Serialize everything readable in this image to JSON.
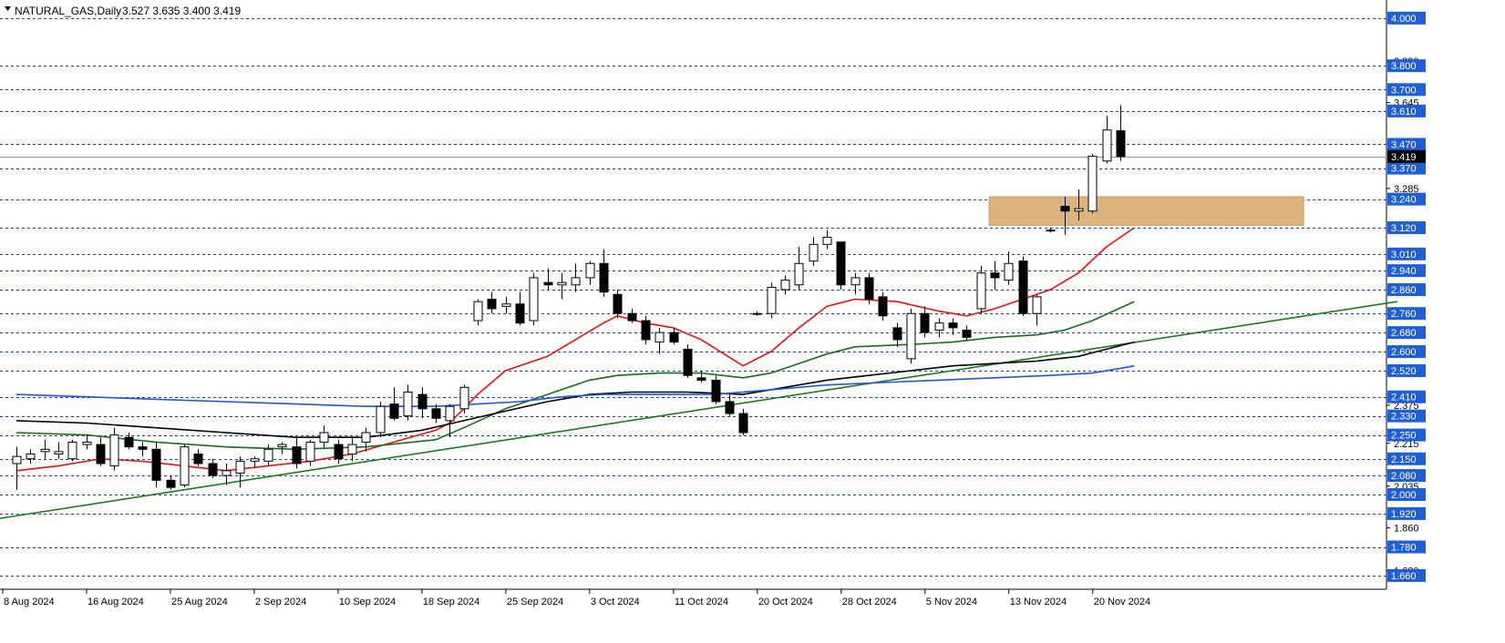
{
  "header": {
    "symbol": "NATURAL_GAS,Daily",
    "ohlc": "3.527 3.635 3.400 3.419"
  },
  "colors": {
    "background": "#ffffff",
    "level_line": "#1f3f9f",
    "level_label": "#1f5fd6",
    "zone": "#dcb47f",
    "ma_fast": "#e81010",
    "ma_mid": "#1a6b1a",
    "ma_black": "#000000",
    "ma_blue": "#2255d8",
    "trendline": "#1a7a1a",
    "candle_up": "#ffffff",
    "candle_down": "#000000",
    "price_label": "#000000"
  },
  "chart_data": {
    "type": "candlestick",
    "title": "NATURAL_GAS,Daily",
    "ylim": [
      1.61,
      4.03
    ],
    "y_ticks": [
      "3.820",
      "3.645",
      "3.285",
      "2.375",
      "2.215",
      "2.035",
      "1.860",
      "1.680"
    ],
    "level_lines": [
      "4.000",
      "3.800",
      "3.700",
      "3.610",
      "3.470",
      "3.370",
      "3.240",
      "3.120",
      "3.010",
      "2.940",
      "2.860",
      "2.760",
      "2.680",
      "2.600",
      "2.520",
      "2.410",
      "2.330",
      "2.250",
      "2.150",
      "2.080",
      "2.000",
      "1.920",
      "1.780",
      "1.660"
    ],
    "current_price": "3.419",
    "x_labels": [
      "8 Aug 2024",
      "16 Aug 2024",
      "25 Aug 2024",
      "2 Sep 2024",
      "10 Sep 2024",
      "18 Sep 2024",
      "25 Sep 2024",
      "3 Oct 2024",
      "11 Oct 2024",
      "20 Oct 2024",
      "28 Oct 2024",
      "5 Nov 2024",
      "13 Nov 2024",
      "20 Nov 2024"
    ],
    "x_label_bars": [
      0,
      6,
      12,
      18,
      24,
      30,
      36,
      42,
      48,
      54,
      60,
      66,
      72,
      78
    ],
    "resistance_zone": {
      "from": 3.13,
      "to": 3.25,
      "start_bar": 70
    },
    "candles": [
      {
        "o": 2.13,
        "h": 2.2,
        "l": 2.02,
        "c": 2.16
      },
      {
        "o": 2.15,
        "h": 2.19,
        "l": 2.13,
        "c": 2.17
      },
      {
        "o": 2.18,
        "h": 2.23,
        "l": 2.15,
        "c": 2.19
      },
      {
        "o": 2.17,
        "h": 2.22,
        "l": 2.15,
        "c": 2.18
      },
      {
        "o": 2.15,
        "h": 2.23,
        "l": 2.14,
        "c": 2.22
      },
      {
        "o": 2.21,
        "h": 2.25,
        "l": 2.19,
        "c": 2.22
      },
      {
        "o": 2.21,
        "h": 2.24,
        "l": 2.12,
        "c": 2.13
      },
      {
        "o": 2.12,
        "h": 2.28,
        "l": 2.1,
        "c": 2.25
      },
      {
        "o": 2.24,
        "h": 2.26,
        "l": 2.19,
        "c": 2.2
      },
      {
        "o": 2.2,
        "h": 2.22,
        "l": 2.16,
        "c": 2.19
      },
      {
        "o": 2.19,
        "h": 2.22,
        "l": 2.03,
        "c": 2.06
      },
      {
        "o": 2.06,
        "h": 2.08,
        "l": 2.02,
        "c": 2.03
      },
      {
        "o": 2.04,
        "h": 2.21,
        "l": 2.03,
        "c": 2.2
      },
      {
        "o": 2.17,
        "h": 2.19,
        "l": 2.12,
        "c": 2.13
      },
      {
        "o": 2.13,
        "h": 2.15,
        "l": 2.07,
        "c": 2.08
      },
      {
        "o": 2.08,
        "h": 2.13,
        "l": 2.04,
        "c": 2.1
      },
      {
        "o": 2.09,
        "h": 2.16,
        "l": 2.03,
        "c": 2.14
      },
      {
        "o": 2.14,
        "h": 2.16,
        "l": 2.11,
        "c": 2.15
      },
      {
        "o": 2.14,
        "h": 2.21,
        "l": 2.12,
        "c": 2.19
      },
      {
        "o": 2.2,
        "h": 2.22,
        "l": 2.17,
        "c": 2.21
      },
      {
        "o": 2.2,
        "h": 2.24,
        "l": 2.11,
        "c": 2.13
      },
      {
        "o": 2.14,
        "h": 2.23,
        "l": 2.12,
        "c": 2.22
      },
      {
        "o": 2.22,
        "h": 2.29,
        "l": 2.19,
        "c": 2.26
      },
      {
        "o": 2.21,
        "h": 2.23,
        "l": 2.13,
        "c": 2.15
      },
      {
        "o": 2.17,
        "h": 2.24,
        "l": 2.14,
        "c": 2.21
      },
      {
        "o": 2.22,
        "h": 2.28,
        "l": 2.18,
        "c": 2.26
      },
      {
        "o": 2.26,
        "h": 2.39,
        "l": 2.24,
        "c": 2.37
      },
      {
        "o": 2.38,
        "h": 2.45,
        "l": 2.31,
        "c": 2.32
      },
      {
        "o": 2.33,
        "h": 2.46,
        "l": 2.31,
        "c": 2.43
      },
      {
        "o": 2.42,
        "h": 2.45,
        "l": 2.32,
        "c": 2.36
      },
      {
        "o": 2.36,
        "h": 2.38,
        "l": 2.3,
        "c": 2.32
      },
      {
        "o": 2.31,
        "h": 2.38,
        "l": 2.24,
        "c": 2.37
      },
      {
        "o": 2.36,
        "h": 2.46,
        "l": 2.34,
        "c": 2.45
      },
      {
        "o": 2.73,
        "h": 2.82,
        "l": 2.71,
        "c": 2.81
      },
      {
        "o": 2.82,
        "h": 2.85,
        "l": 2.76,
        "c": 2.78
      },
      {
        "o": 2.79,
        "h": 2.83,
        "l": 2.76,
        "c": 2.8
      },
      {
        "o": 2.8,
        "h": 2.85,
        "l": 2.71,
        "c": 2.72
      },
      {
        "o": 2.73,
        "h": 2.93,
        "l": 2.71,
        "c": 2.91
      },
      {
        "o": 2.89,
        "h": 2.95,
        "l": 2.86,
        "c": 2.88
      },
      {
        "o": 2.88,
        "h": 2.93,
        "l": 2.82,
        "c": 2.89
      },
      {
        "o": 2.88,
        "h": 2.97,
        "l": 2.85,
        "c": 2.91
      },
      {
        "o": 2.91,
        "h": 2.98,
        "l": 2.88,
        "c": 2.97
      },
      {
        "o": 2.97,
        "h": 3.03,
        "l": 2.83,
        "c": 2.85
      },
      {
        "o": 2.84,
        "h": 2.86,
        "l": 2.74,
        "c": 2.76
      },
      {
        "o": 2.76,
        "h": 2.78,
        "l": 2.72,
        "c": 2.73
      },
      {
        "o": 2.73,
        "h": 2.75,
        "l": 2.63,
        "c": 2.65
      },
      {
        "o": 2.64,
        "h": 2.7,
        "l": 2.59,
        "c": 2.68
      },
      {
        "o": 2.68,
        "h": 2.7,
        "l": 2.63,
        "c": 2.64
      },
      {
        "o": 2.61,
        "h": 2.63,
        "l": 2.49,
        "c": 2.5
      },
      {
        "o": 2.49,
        "h": 2.52,
        "l": 2.47,
        "c": 2.48
      },
      {
        "o": 2.48,
        "h": 2.5,
        "l": 2.38,
        "c": 2.39
      },
      {
        "o": 2.39,
        "h": 2.42,
        "l": 2.33,
        "c": 2.34
      },
      {
        "o": 2.34,
        "h": 2.36,
        "l": 2.25,
        "c": 2.26
      },
      {
        "o": 2.76,
        "h": 2.77,
        "l": 2.75,
        "c": 2.76
      },
      {
        "o": 2.76,
        "h": 2.89,
        "l": 2.74,
        "c": 2.87
      },
      {
        "o": 2.86,
        "h": 2.92,
        "l": 2.84,
        "c": 2.9
      },
      {
        "o": 2.88,
        "h": 3.04,
        "l": 2.86,
        "c": 2.97
      },
      {
        "o": 2.98,
        "h": 3.08,
        "l": 2.96,
        "c": 3.05
      },
      {
        "o": 3.05,
        "h": 3.11,
        "l": 3.03,
        "c": 3.08
      },
      {
        "o": 3.06,
        "h": 3.06,
        "l": 2.86,
        "c": 2.88
      },
      {
        "o": 2.88,
        "h": 2.93,
        "l": 2.84,
        "c": 2.91
      },
      {
        "o": 2.91,
        "h": 2.93,
        "l": 2.8,
        "c": 2.82
      },
      {
        "o": 2.83,
        "h": 2.85,
        "l": 2.73,
        "c": 2.75
      },
      {
        "o": 2.7,
        "h": 2.72,
        "l": 2.62,
        "c": 2.65
      },
      {
        "o": 2.57,
        "h": 2.78,
        "l": 2.55,
        "c": 2.76
      },
      {
        "o": 2.76,
        "h": 2.79,
        "l": 2.66,
        "c": 2.68
      },
      {
        "o": 2.69,
        "h": 2.74,
        "l": 2.66,
        "c": 2.72
      },
      {
        "o": 2.72,
        "h": 2.74,
        "l": 2.67,
        "c": 2.7
      },
      {
        "o": 2.69,
        "h": 2.71,
        "l": 2.65,
        "c": 2.66
      },
      {
        "o": 2.78,
        "h": 2.96,
        "l": 2.76,
        "c": 2.93
      },
      {
        "o": 2.93,
        "h": 2.98,
        "l": 2.86,
        "c": 2.91
      },
      {
        "o": 2.9,
        "h": 3.02,
        "l": 2.88,
        "c": 2.97
      },
      {
        "o": 2.98,
        "h": 3.0,
        "l": 2.75,
        "c": 2.76
      },
      {
        "o": 2.76,
        "h": 2.84,
        "l": 2.71,
        "c": 2.83
      },
      {
        "o": 3.11,
        "h": 3.12,
        "l": 3.1,
        "c": 3.11
      },
      {
        "o": 3.21,
        "h": 3.25,
        "l": 3.09,
        "c": 3.19
      },
      {
        "o": 3.19,
        "h": 3.28,
        "l": 3.15,
        "c": 3.2
      },
      {
        "o": 3.19,
        "h": 3.43,
        "l": 3.18,
        "c": 3.42
      },
      {
        "o": 3.4,
        "h": 3.59,
        "l": 3.39,
        "c": 3.53
      },
      {
        "o": 3.527,
        "h": 3.635,
        "l": 3.4,
        "c": 3.419
      }
    ],
    "series": [
      {
        "key": "ma_fast",
        "points": [
          [
            0,
            2.1
          ],
          [
            3,
            2.12
          ],
          [
            6,
            2.15
          ],
          [
            9,
            2.14
          ],
          [
            12,
            2.12
          ],
          [
            15,
            2.1
          ],
          [
            18,
            2.12
          ],
          [
            21,
            2.14
          ],
          [
            24,
            2.17
          ],
          [
            27,
            2.22
          ],
          [
            30,
            2.27
          ],
          [
            31,
            2.3
          ],
          [
            33,
            2.42
          ],
          [
            35,
            2.52
          ],
          [
            38,
            2.58
          ],
          [
            42,
            2.72
          ],
          [
            43,
            2.75
          ],
          [
            45,
            2.72
          ],
          [
            47,
            2.7
          ],
          [
            49,
            2.65
          ],
          [
            52,
            2.54
          ],
          [
            54,
            2.6
          ],
          [
            56,
            2.7
          ],
          [
            58,
            2.79
          ],
          [
            60,
            2.82
          ],
          [
            63,
            2.81
          ],
          [
            66,
            2.77
          ],
          [
            68,
            2.75
          ],
          [
            70,
            2.78
          ],
          [
            72,
            2.82
          ],
          [
            74,
            2.86
          ],
          [
            76,
            2.93
          ],
          [
            78,
            3.04
          ],
          [
            80,
            3.12
          ]
        ]
      },
      {
        "key": "ma_mid",
        "points": [
          [
            0,
            2.26
          ],
          [
            5,
            2.25
          ],
          [
            10,
            2.22
          ],
          [
            15,
            2.2
          ],
          [
            20,
            2.19
          ],
          [
            25,
            2.2
          ],
          [
            30,
            2.23
          ],
          [
            32,
            2.28
          ],
          [
            35,
            2.36
          ],
          [
            38,
            2.42
          ],
          [
            41,
            2.48
          ],
          [
            43,
            2.5
          ],
          [
            46,
            2.51
          ],
          [
            49,
            2.51
          ],
          [
            52,
            2.49
          ],
          [
            54,
            2.51
          ],
          [
            56,
            2.55
          ],
          [
            58,
            2.59
          ],
          [
            60,
            2.62
          ],
          [
            64,
            2.63
          ],
          [
            67,
            2.64
          ],
          [
            70,
            2.66
          ],
          [
            73,
            2.67
          ],
          [
            75,
            2.69
          ],
          [
            77,
            2.73
          ],
          [
            80,
            2.81
          ]
        ]
      },
      {
        "key": "ma_black",
        "points": [
          [
            0,
            2.31
          ],
          [
            5,
            2.3
          ],
          [
            10,
            2.28
          ],
          [
            15,
            2.26
          ],
          [
            20,
            2.24
          ],
          [
            25,
            2.24
          ],
          [
            29,
            2.27
          ],
          [
            32,
            2.31
          ],
          [
            35,
            2.35
          ],
          [
            38,
            2.39
          ],
          [
            41,
            2.42
          ],
          [
            44,
            2.43
          ],
          [
            48,
            2.43
          ],
          [
            52,
            2.42
          ],
          [
            55,
            2.45
          ],
          [
            58,
            2.48
          ],
          [
            61,
            2.5
          ],
          [
            64,
            2.52
          ],
          [
            67,
            2.54
          ],
          [
            70,
            2.55
          ],
          [
            73,
            2.56
          ],
          [
            76,
            2.58
          ],
          [
            78,
            2.61
          ],
          [
            80,
            2.64
          ]
        ]
      },
      {
        "key": "ma_blue",
        "points": [
          [
            0,
            2.42
          ],
          [
            5,
            2.41
          ],
          [
            10,
            2.4
          ],
          [
            15,
            2.39
          ],
          [
            20,
            2.38
          ],
          [
            25,
            2.37
          ],
          [
            30,
            2.37
          ],
          [
            33,
            2.38
          ],
          [
            36,
            2.39
          ],
          [
            39,
            2.41
          ],
          [
            42,
            2.42
          ],
          [
            46,
            2.42
          ],
          [
            50,
            2.42
          ],
          [
            54,
            2.44
          ],
          [
            58,
            2.46
          ],
          [
            62,
            2.47
          ],
          [
            66,
            2.48
          ],
          [
            70,
            2.49
          ],
          [
            74,
            2.5
          ],
          [
            77,
            2.51
          ],
          [
            79,
            2.53
          ],
          [
            80,
            2.54
          ]
        ]
      }
    ],
    "trendline": {
      "from": [
        0,
        1.9
      ],
      "to": [
        100,
        2.81
      ]
    }
  }
}
